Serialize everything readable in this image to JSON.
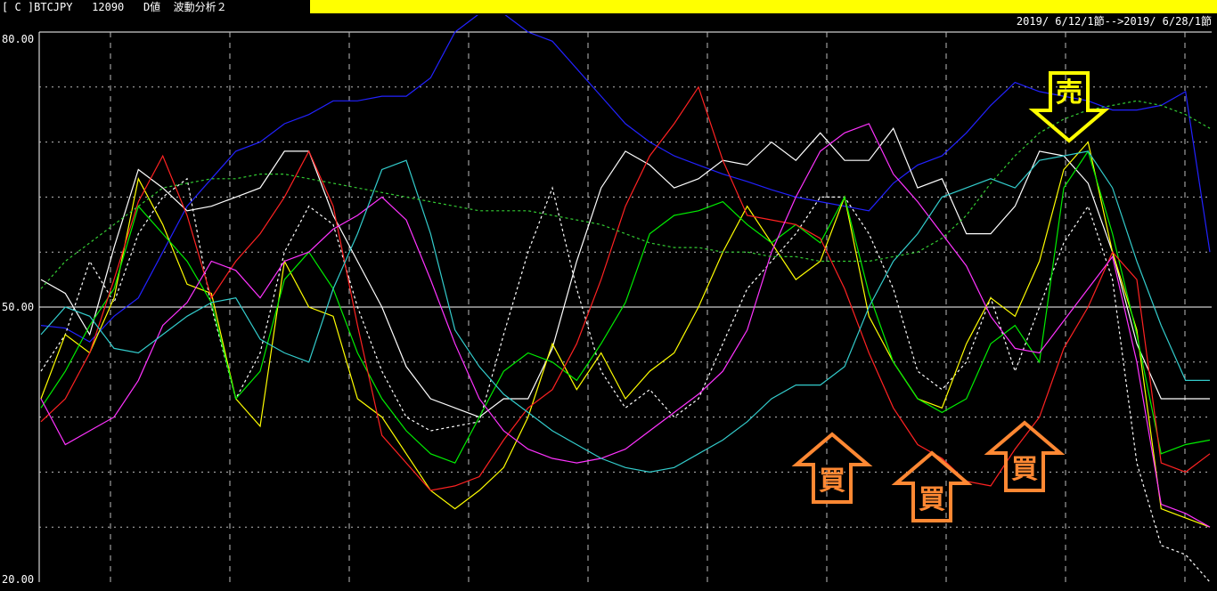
{
  "header": {
    "title": "[ C ]BTCJPY   12090   D値  波動分析２",
    "range": "2019/ 6/12/1節-->2019/ 6/28/1節",
    "highlight_color": "#ffff00"
  },
  "chart_data": {
    "type": "line",
    "ylim": [
      20,
      80
    ],
    "yticks": [
      "80.00",
      "50.00",
      "20.00"
    ],
    "x_count": 49,
    "series": [
      {
        "color": "#2222ff",
        "dash": "",
        "values": [
          48.0,
          47.7,
          46.2,
          49.0,
          51.0,
          56.0,
          61.0,
          64.0,
          67.0,
          68.0,
          70.0,
          71.0,
          72.5,
          72.5,
          73.0,
          73.0,
          75.0,
          80.0,
          82.0,
          82.0,
          80.0,
          79.0,
          76.0,
          73.0,
          70.0,
          68.0,
          66.5,
          65.5,
          64.5,
          63.7,
          62.8,
          62.0,
          61.5,
          61.0,
          60.5,
          63.5,
          65.5,
          66.5,
          69.0,
          72.0,
          74.5,
          73.5,
          73.0,
          72.5,
          71.5,
          71.5,
          72.0,
          73.5,
          56.0
        ]
      },
      {
        "color": "#ffffff",
        "dash": "",
        "values": [
          53.0,
          51.5,
          47.0,
          56.5,
          65.0,
          63.0,
          60.5,
          61.0,
          62.0,
          63.0,
          67.0,
          67.0,
          60.0,
          55.0,
          50.0,
          43.5,
          40.0,
          39.0,
          38.0,
          40.0,
          40.0,
          45.5,
          55.0,
          63.0,
          67.0,
          65.5,
          63.0,
          64.0,
          66.0,
          65.5,
          68.0,
          66.0,
          69.0,
          66.0,
          66.0,
          69.5,
          63.0,
          64.0,
          58.0,
          58.0,
          61.0,
          67.0,
          66.5,
          63.5,
          56.0,
          46.0,
          40.0,
          40.0,
          40.0
        ]
      },
      {
        "color": "#ffffff",
        "dash": "3,3",
        "values": [
          43.0,
          47.0,
          55.0,
          50.5,
          58.0,
          62.0,
          64.0,
          50.0,
          40.0,
          45.0,
          56.0,
          61.0,
          59.0,
          50.0,
          43.0,
          38.0,
          36.5,
          37.0,
          37.5,
          47.0,
          56.0,
          63.0,
          52.0,
          43.0,
          39.0,
          41.0,
          38.0,
          40.0,
          46.0,
          52.0,
          55.0,
          58.0,
          62.0,
          62.0,
          58.0,
          52.0,
          43.0,
          41.0,
          44.0,
          51.0,
          43.0,
          50.0,
          57.0,
          61.0,
          53.0,
          33.0,
          24.0,
          23.0,
          20.0
        ]
      },
      {
        "color": "#ffff00",
        "dash": "",
        "values": [
          40.0,
          47.0,
          45.0,
          51.0,
          64.0,
          59.0,
          52.5,
          51.5,
          40.0,
          37.0,
          55.0,
          50.0,
          49.0,
          40.0,
          38.0,
          34.0,
          30.0,
          28.0,
          30.0,
          32.5,
          38.0,
          46.0,
          41.0,
          45.0,
          40.0,
          43.0,
          45.0,
          50.0,
          56.0,
          61.0,
          57.0,
          53.0,
          55.0,
          62.0,
          49.0,
          44.0,
          40.0,
          39.0,
          46.0,
          51.0,
          49.0,
          55.0,
          65.0,
          68.0,
          56.0,
          47.5,
          28.0,
          27.0,
          26.0
        ]
      },
      {
        "color": "#00ee00",
        "dash": "",
        "values": [
          39.0,
          43.0,
          48.0,
          52.0,
          61.0,
          58.0,
          55.0,
          50.5,
          40.0,
          43.0,
          53.0,
          56.0,
          52.0,
          45.0,
          40.0,
          36.5,
          34.0,
          33.0,
          38.0,
          43.0,
          45.0,
          44.0,
          42.0,
          46.0,
          50.5,
          58.0,
          60.0,
          60.5,
          61.5,
          59.0,
          57.0,
          59.0,
          57.0,
          62.0,
          51.5,
          44.0,
          40.0,
          38.5,
          40.0,
          46.0,
          48.0,
          44.0,
          63.0,
          67.0,
          58.0,
          47.0,
          34.0,
          35.0,
          35.5
        ]
      },
      {
        "color": "#ff2222",
        "dash": "",
        "values": [
          37.5,
          40.0,
          45.0,
          53.0,
          61.5,
          66.5,
          60.0,
          51.0,
          55.0,
          58.0,
          62.0,
          67.0,
          61.0,
          48.0,
          36.0,
          33.0,
          30.0,
          30.5,
          31.5,
          35.5,
          39.0,
          41.0,
          46.0,
          53.0,
          61.0,
          66.5,
          70.0,
          74.0,
          66.0,
          60.0,
          59.5,
          59.0,
          57.5,
          52.0,
          45.0,
          39.0,
          35.0,
          33.5,
          31.0,
          30.5,
          34.5,
          38.0,
          45.5,
          50.0,
          56.0,
          53.0,
          33.0,
          32.0,
          34.0
        ]
      },
      {
        "color": "#ff33ff",
        "dash": "",
        "values": [
          40.0,
          35.0,
          36.5,
          38.0,
          42.0,
          48.0,
          50.5,
          55.0,
          54.0,
          51.0,
          55.0,
          56.0,
          58.5,
          60.0,
          62.0,
          59.5,
          53.0,
          46.0,
          40.0,
          36.5,
          34.5,
          33.5,
          33.0,
          33.5,
          34.5,
          36.5,
          38.5,
          40.5,
          43.0,
          47.5,
          56.0,
          62.0,
          67.0,
          69.0,
          70.0,
          64.5,
          61.5,
          58.0,
          54.5,
          49.0,
          45.5,
          45.0,
          48.5,
          52.0,
          55.5,
          44.0,
          28.5,
          27.5,
          26.0
        ]
      },
      {
        "color": "#33cccc",
        "dash": "",
        "values": [
          47.0,
          50.0,
          49.0,
          45.5,
          45.0,
          47.0,
          49.0,
          50.5,
          51.0,
          46.5,
          45.0,
          44.0,
          52.0,
          58.0,
          65.0,
          66.0,
          58.0,
          47.5,
          43.5,
          40.5,
          38.5,
          36.5,
          35.0,
          33.5,
          32.5,
          32.0,
          32.5,
          34.0,
          35.5,
          37.5,
          40.0,
          41.5,
          41.5,
          43.5,
          50.0,
          55.0,
          58.0,
          62.0,
          63.0,
          64.0,
          63.0,
          66.0,
          66.5,
          67.0,
          63.0,
          55.0,
          48.0,
          42.0,
          42.0
        ]
      },
      {
        "color": "#33cc33",
        "dash": "3,3",
        "values": [
          52.0,
          55.0,
          57.0,
          59.0,
          61.0,
          63.0,
          63.5,
          64.0,
          64.0,
          64.5,
          64.5,
          64.0,
          63.5,
          63.0,
          62.5,
          62.0,
          61.5,
          61.0,
          60.5,
          60.5,
          60.5,
          60.0,
          59.5,
          59.0,
          58.0,
          57.0,
          56.5,
          56.5,
          56.0,
          56.0,
          55.5,
          55.5,
          55.0,
          55.0,
          55.0,
          55.5,
          56.0,
          57.5,
          60.0,
          63.5,
          66.5,
          69.0,
          70.5,
          71.5,
          72.0,
          72.5,
          72.0,
          71.0,
          69.5
        ]
      }
    ]
  },
  "annotations": [
    {
      "label": "売",
      "type": "sell",
      "color": "#ffff00"
    },
    {
      "label": "買",
      "type": "buy",
      "color": "#ff8833"
    },
    {
      "label": "買",
      "type": "buy",
      "color": "#ff8833"
    },
    {
      "label": "買",
      "type": "buy",
      "color": "#ff8833"
    }
  ]
}
